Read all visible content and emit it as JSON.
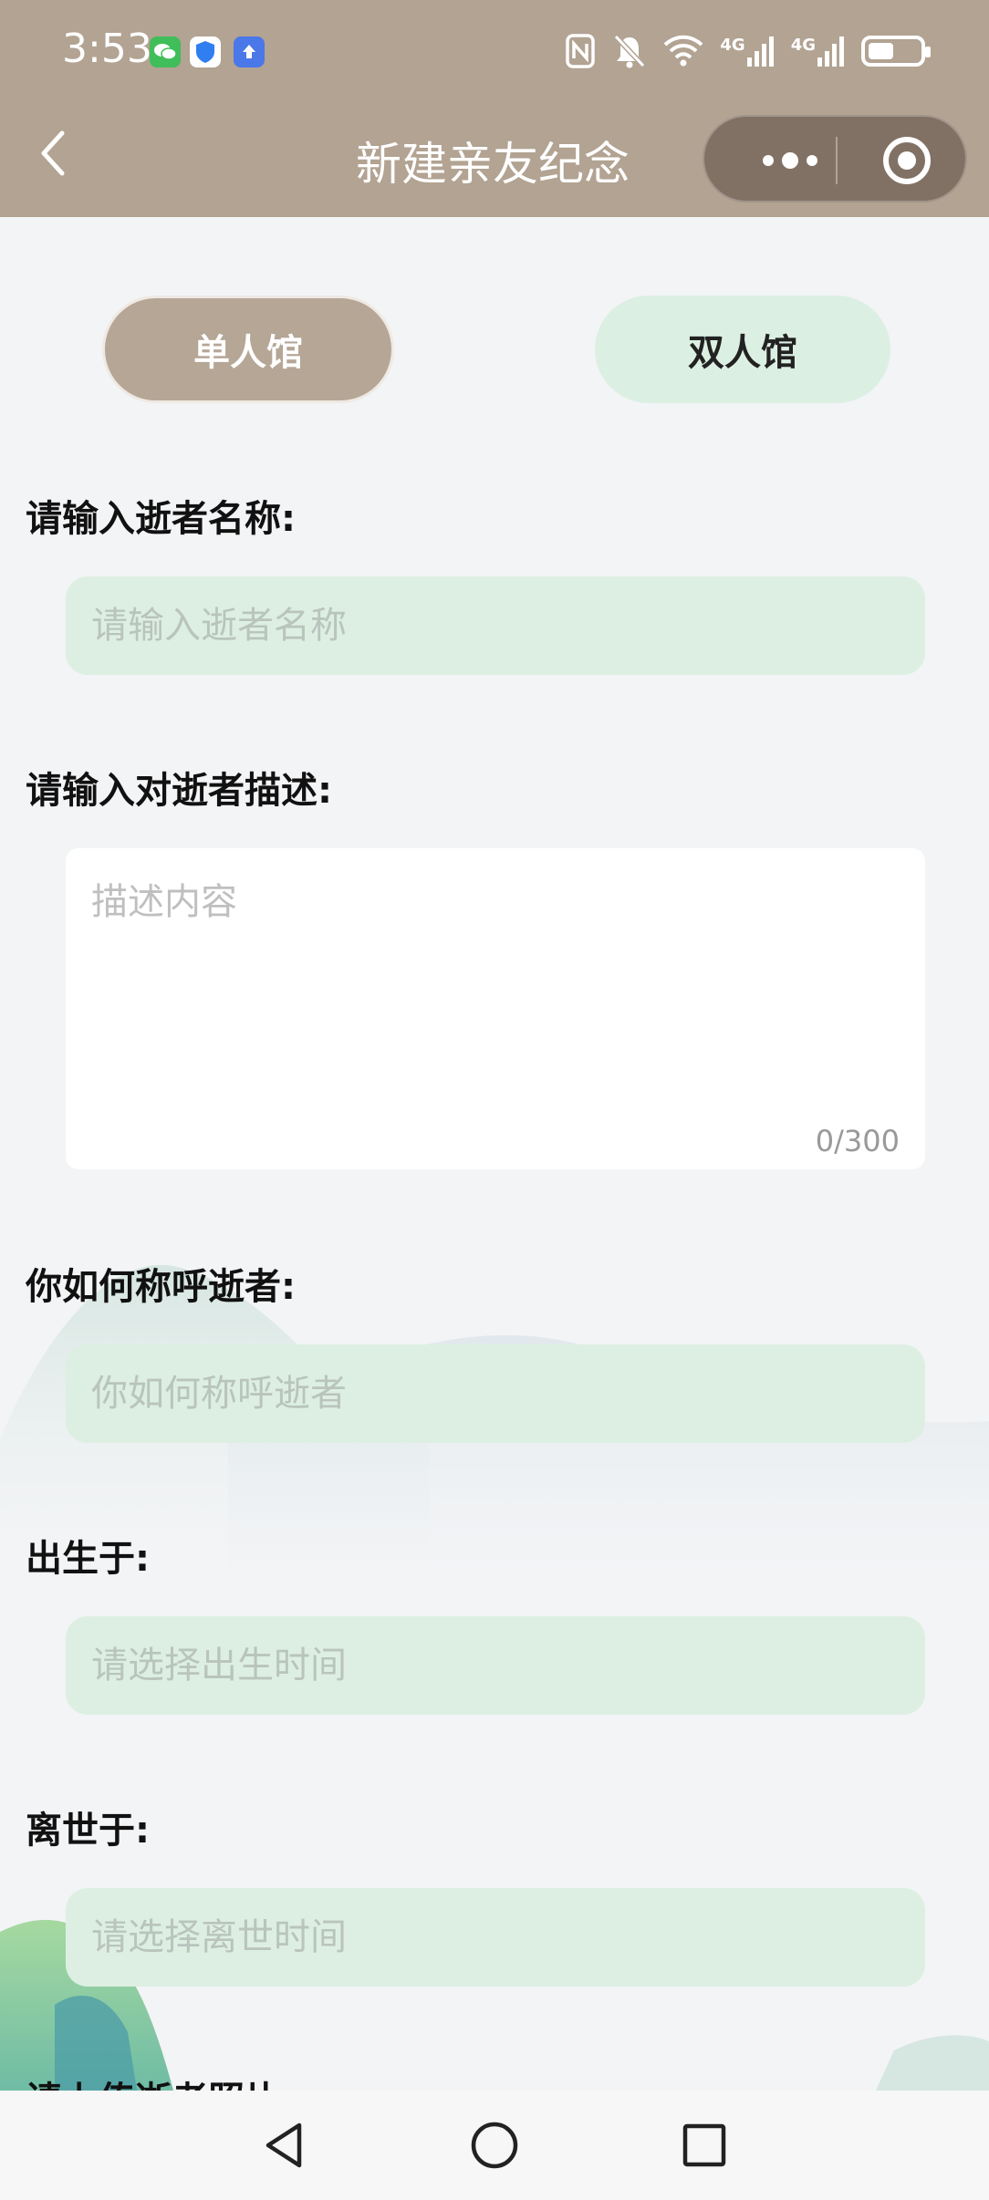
{
  "status_bar": {
    "time": "3:53",
    "app_icons": [
      "wechat-icon",
      "shield-icon",
      "upload-icon"
    ],
    "right_icons": [
      "nfc-icon",
      "bell-muted-icon",
      "wifi-icon",
      "signal-4g-icon",
      "signal-4g-icon",
      "battery-icon"
    ],
    "signal_labels": [
      "4G",
      "4G"
    ],
    "battery_level": 0.5
  },
  "navbar": {
    "title": "新建亲友纪念",
    "icons": [
      "back-icon",
      "more-icon",
      "target-icon"
    ]
  },
  "tabs": [
    {
      "label": "单人馆",
      "selected": true
    },
    {
      "label": "双人馆",
      "selected": false
    }
  ],
  "form": {
    "name": {
      "label": "请输入逝者名称:",
      "placeholder": "请输入逝者名称",
      "value": ""
    },
    "description": {
      "label": "请输入对逝者描述:",
      "placeholder": "描述内容",
      "value": "",
      "counter": "0/300"
    },
    "address": {
      "label": "你如何称呼逝者:",
      "placeholder": "你如何称呼逝者",
      "value": ""
    },
    "birth": {
      "label": "出生于:",
      "placeholder": "请选择出生时间",
      "value": ""
    },
    "death": {
      "label": "离世于:",
      "placeholder": "请选择离世时间",
      "value": ""
    },
    "photo": {
      "label": "请上传逝者照片:"
    }
  },
  "system_nav": {
    "icons": [
      "nav-back-icon",
      "nav-home-icon",
      "nav-recents-icon"
    ]
  },
  "colors": {
    "header": "#b2a392",
    "tab_selected": "#b5a696",
    "tab_unselected": "#dcefe3",
    "field_bg": "#ddefe3",
    "page_bg": "#f3f4f6"
  }
}
